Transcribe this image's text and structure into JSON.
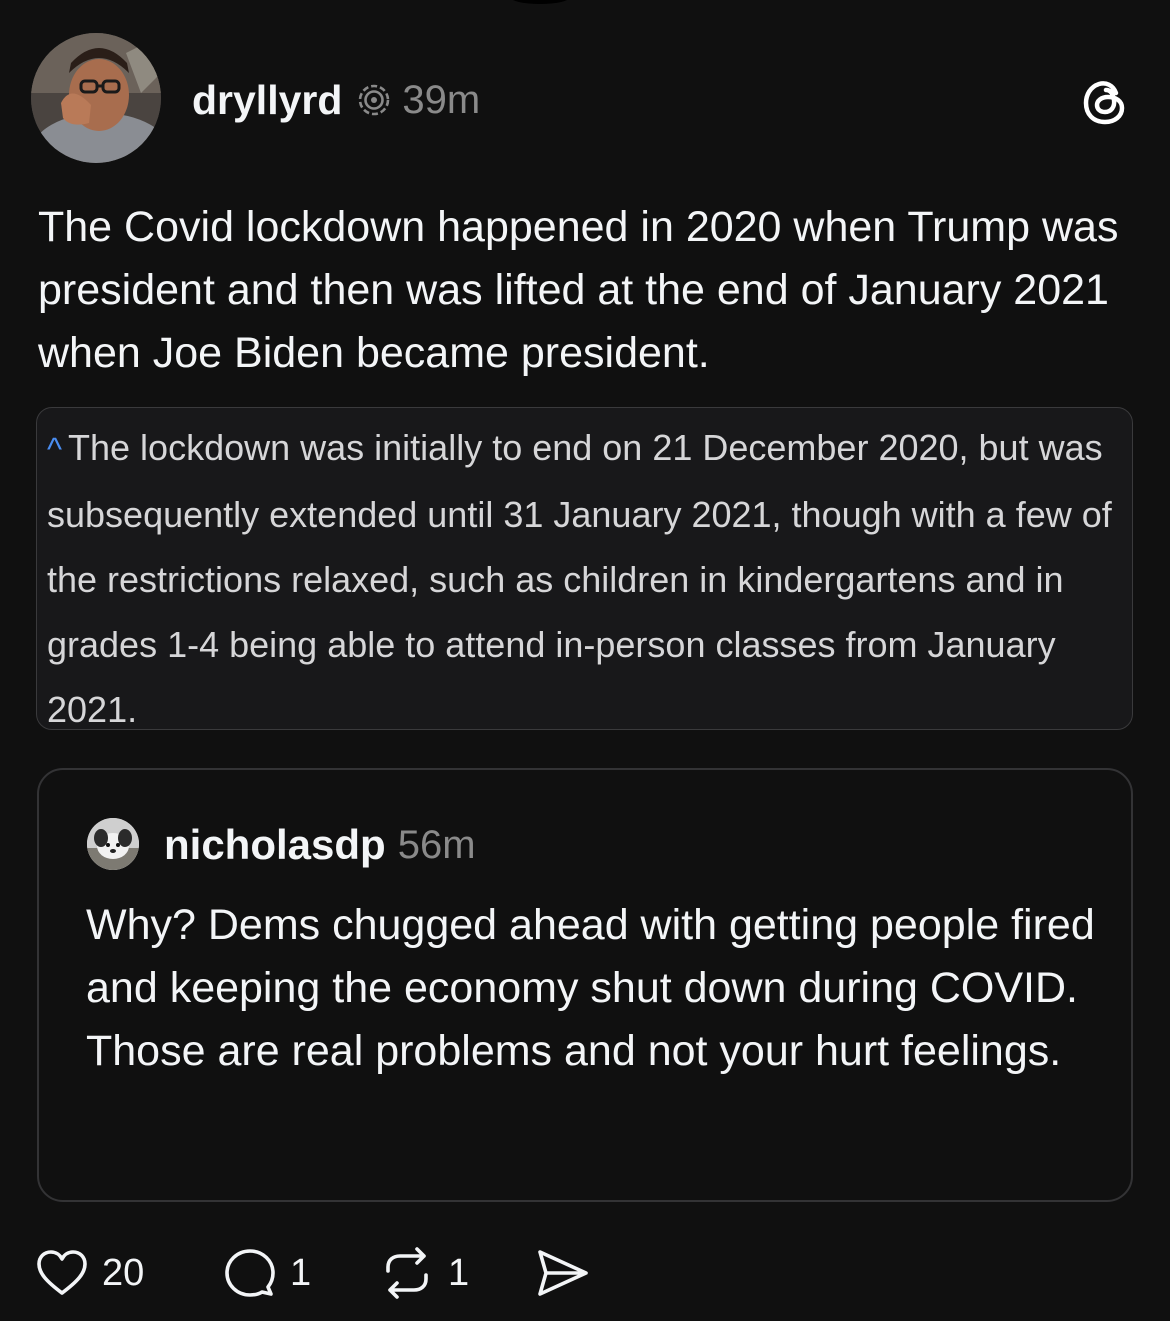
{
  "post": {
    "author": {
      "username": "dryllyrd",
      "time_ago": "39m",
      "avatar_icon": "profile-photo"
    },
    "text": "The Covid lockdown happened in 2020 when Trump was president and then was lifted at the end of January 2021 when Joe Biden became president.",
    "quote_excerpt": {
      "caret": "^",
      "text": "The lockdown was initially to end on 21 December 2020, but was subsequently extended until 31 January 2021, though with a few of the restrictions relaxed, such as children in kindergartens and in grades 1-4 being able to attend in-person classes from January 2021."
    },
    "quoted_post": {
      "username": "nicholasdp",
      "time_ago": "56m",
      "avatar_icon": "dog-photo",
      "text": "Why? Dems chugged ahead with getting people fired and keeping the economy shut down during COVID. Those are real problems and not your hurt feelings."
    },
    "actions": {
      "likes": "20",
      "replies": "1",
      "reposts": "1"
    }
  },
  "icons": {
    "header_right": "threads-logo-icon",
    "verify": "fediverse-icon",
    "like": "heart-icon",
    "reply": "comment-icon",
    "repost": "repost-icon",
    "share": "send-icon"
  },
  "colors": {
    "background": "#101010",
    "text": "#f3f5f7",
    "muted": "#8a8a8a",
    "caret": "#4a8df0"
  }
}
